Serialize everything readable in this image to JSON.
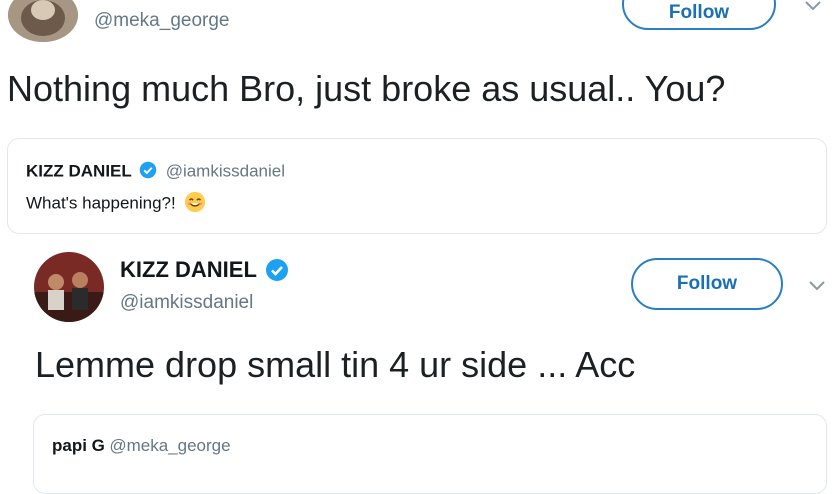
{
  "tweet1": {
    "handle": "@meka_george",
    "follow_label": "Follow",
    "text": "Nothing much Bro, just broke as usual.. You?",
    "quote": {
      "name": "KIZZ DANIEL",
      "handle": "@iamkissdaniel",
      "text": "What's happening?!",
      "emoji": "smiling-face-icon"
    }
  },
  "tweet2": {
    "name": "KIZZ DANIEL",
    "handle": "@iamkissdaniel",
    "follow_label": "Follow",
    "text": "Lemme drop small tin 4 ur side ... Acc",
    "quote": {
      "name": "papi G",
      "handle": "@meka_george"
    }
  },
  "colors": {
    "accent": "#1b6fb3",
    "verified": "#1da1f2",
    "muted": "#657786"
  }
}
